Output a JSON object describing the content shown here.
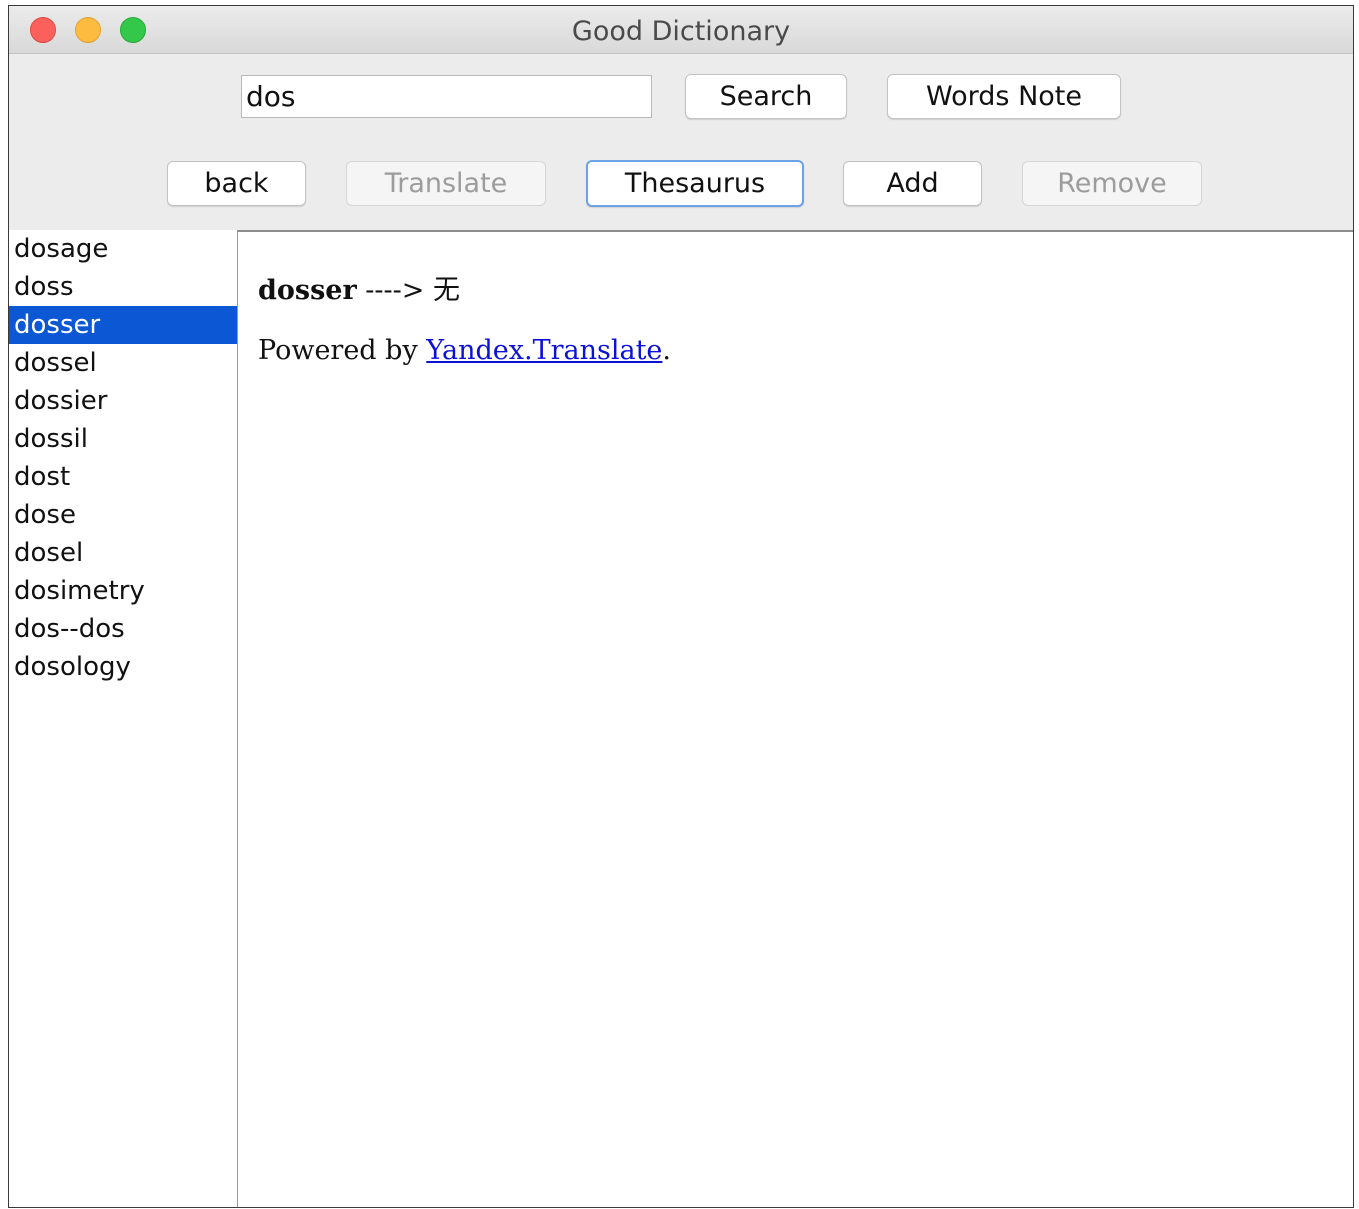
{
  "window": {
    "title": "Good Dictionary"
  },
  "toolbar": {
    "search": {
      "value": "dos"
    },
    "search_button": "Search",
    "words_note_button": "Words Note",
    "back_button": "back",
    "translate_button": "Translate",
    "thesaurus_button": "Thesaurus",
    "add_button": "Add",
    "remove_button": "Remove"
  },
  "sidebar": {
    "selected": "dosser",
    "items": [
      {
        "label": "dosage"
      },
      {
        "label": "doss"
      },
      {
        "label": "dosser"
      },
      {
        "label": "dossel"
      },
      {
        "label": "dossier"
      },
      {
        "label": "dossil"
      },
      {
        "label": "dost"
      },
      {
        "label": "dose"
      },
      {
        "label": "dosel"
      },
      {
        "label": "dosimetry"
      },
      {
        "label": "dos--dos"
      },
      {
        "label": "dosology"
      }
    ]
  },
  "content": {
    "word": "dosser",
    "arrow": " ----> ",
    "translation": "无",
    "powered_prefix": "Powered by ",
    "powered_link": "Yandex.Translate",
    "powered_suffix": "."
  },
  "colors": {
    "selection": "#0c57d4",
    "link": "#0b11d6",
    "focus_ring": "#6ba2e8",
    "close": "#fc605c",
    "minimize": "#fdbc40",
    "maximize": "#34c84a"
  }
}
